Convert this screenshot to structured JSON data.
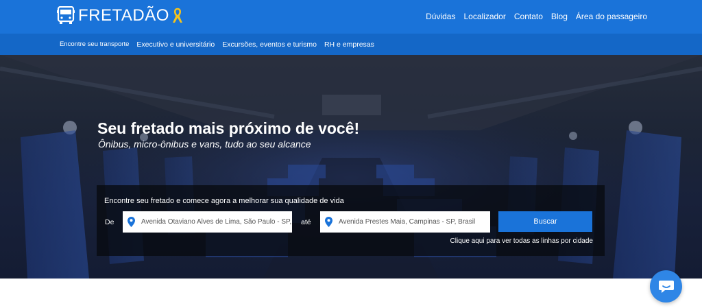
{
  "header": {
    "logo_text": "FRETADÃO",
    "nav": [
      "Dúvidas",
      "Localizador",
      "Contato",
      "Blog",
      "Área do passageiro"
    ]
  },
  "subnav": [
    "Encontre seu transporte",
    "Executivo e universitário",
    "Excursões, eventos e turismo",
    "RH e empresas"
  ],
  "hero": {
    "title": "Seu fretado mais próximo de você!",
    "subtitle": "Ônibus, micro-ônibus e vans, tudo ao seu alcance"
  },
  "search": {
    "caption": "Encontre seu fretado e comece agora a melhorar sua qualidade de vida",
    "from_label": "De",
    "from_value": "Avenida Otaviano Alves de Lima, São Paulo - SP, Brasil",
    "to_label": "até",
    "to_value": "Avenida Prestes Maia, Campinas - SP, Brasil",
    "button_label": "Buscar",
    "all_lines_link": "Clique aqui para ver todas as linhas por cidade"
  },
  "colors": {
    "primary": "#1a73d9",
    "secondary": "#1467c7",
    "ribbon": "#f2c31f"
  },
  "icons": {
    "logo": "bus-icon",
    "ribbon": "awareness-ribbon-icon",
    "field": "map-pin-icon",
    "chat": "chat-bubble-icon"
  }
}
